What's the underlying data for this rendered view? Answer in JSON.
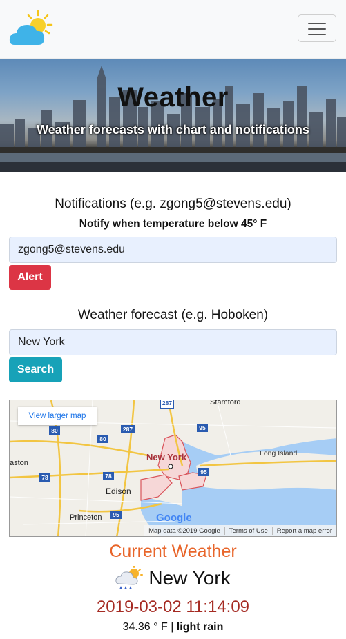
{
  "navbar": {
    "logo_icon": "sun-cloud-icon",
    "menu_icon": "hamburger-icon"
  },
  "hero": {
    "title": "Weather",
    "subtitle": "Weather forecasts with chart and notifications"
  },
  "notifications": {
    "title": "Notifications (e.g. zgong5@stevens.edu)",
    "subtitle": "Notify when temperature below 45° F",
    "email_value": "zgong5@stevens.edu",
    "button_label": "Alert"
  },
  "forecast": {
    "title": "Weather forecast (e.g. Hoboken)",
    "city_value": "New York",
    "button_label": "Search"
  },
  "map": {
    "larger_map_link": "View larger map",
    "labels": {
      "new_york": "New York",
      "long_island": "Long Island",
      "edison": "Edison",
      "princeton": "Princeton",
      "stamford": "Stamford",
      "easton": "aston"
    },
    "highways": [
      "287",
      "80",
      "287",
      "95",
      "78",
      "78",
      "95",
      "95",
      "80"
    ],
    "brand": "Google",
    "footer": {
      "data": "Map data ©2019 Google",
      "terms": "Terms of Use",
      "report": "Report a map error"
    }
  },
  "current": {
    "title": "Current Weather",
    "city": "New York",
    "weather_icon": "rain-cloud-sun-icon",
    "timestamp": "2019-03-02 11:14:09",
    "temperature": "34.36 ° F",
    "separator": "|",
    "description": "light rain"
  },
  "colors": {
    "alert": "#dc3545",
    "search": "#17a2b8",
    "current_title": "#e8652a",
    "timestamp": "#a52a22"
  }
}
